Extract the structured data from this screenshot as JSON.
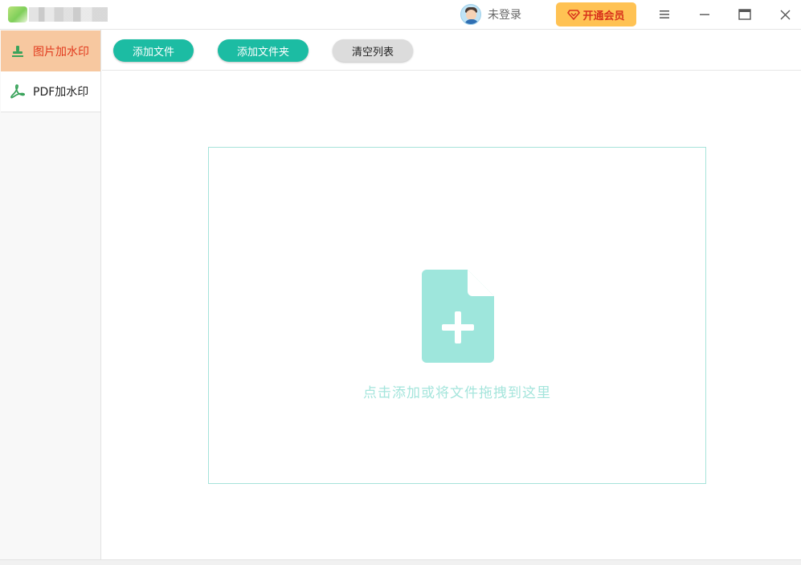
{
  "titlebar": {
    "user_label": "未登录",
    "vip_label": "开通会员",
    "icons": {
      "menu": "menu-icon",
      "minimize": "minimize-icon",
      "maximize": "maximize-icon",
      "close": "close-icon"
    }
  },
  "sidebar": {
    "items": [
      {
        "label": "图片加水印",
        "icon": "stamp-icon",
        "active": true
      },
      {
        "label": "PDF加水印",
        "icon": "pdf-icon",
        "active": false
      }
    ]
  },
  "toolbar": {
    "add_file_label": "添加文件",
    "add_folder_label": "添加文件夹",
    "clear_list_label": "清空列表"
  },
  "main": {
    "drop_text": "点击添加或将文件拖拽到这里"
  },
  "colors": {
    "accent": "#1cbca3",
    "active_tab_bg": "#f7c8a0",
    "active_tab_text": "#e23a1d",
    "vip_bg": "#ffc253",
    "drop_icon": "#9ee6dc"
  }
}
